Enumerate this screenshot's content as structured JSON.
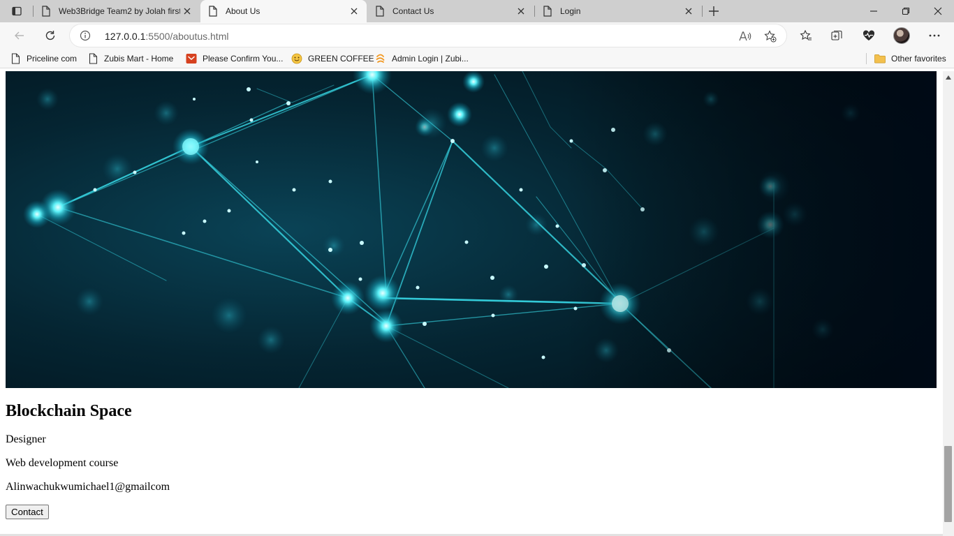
{
  "browser": {
    "tabs": [
      {
        "title": "Web3Bridge Team2 by Jolah first",
        "active": false
      },
      {
        "title": "About Us",
        "active": true
      },
      {
        "title": "Contact Us",
        "active": false
      },
      {
        "title": "Login",
        "active": false
      }
    ],
    "address": {
      "host": "127.0.0.1",
      "path": ":5500/aboutus.html"
    },
    "bookmarks": [
      {
        "label": "Priceline com",
        "icon": "page-icon"
      },
      {
        "label": "Zubis Mart - Home",
        "icon": "page-icon"
      },
      {
        "label": "Please Confirm You...",
        "icon": "mail-icon"
      },
      {
        "label": "GREEN COFFEE",
        "icon": "smiley-icon"
      },
      {
        "label": "Admin Login | Zubi...",
        "icon": "swirl-icon"
      }
    ],
    "other_favorites": "Other favorites",
    "colors": {
      "tabstrip": "#cfcfcf",
      "toolbar": "#f7f7f7",
      "hero_bg": "#01141d",
      "network_glow": "#36e6f2"
    }
  },
  "page": {
    "heading": "Blockchain Space",
    "role": "Designer",
    "course": "Web development course",
    "email": "Alinwachukwumichael1@gmailcom",
    "contact_button": "Contact"
  }
}
